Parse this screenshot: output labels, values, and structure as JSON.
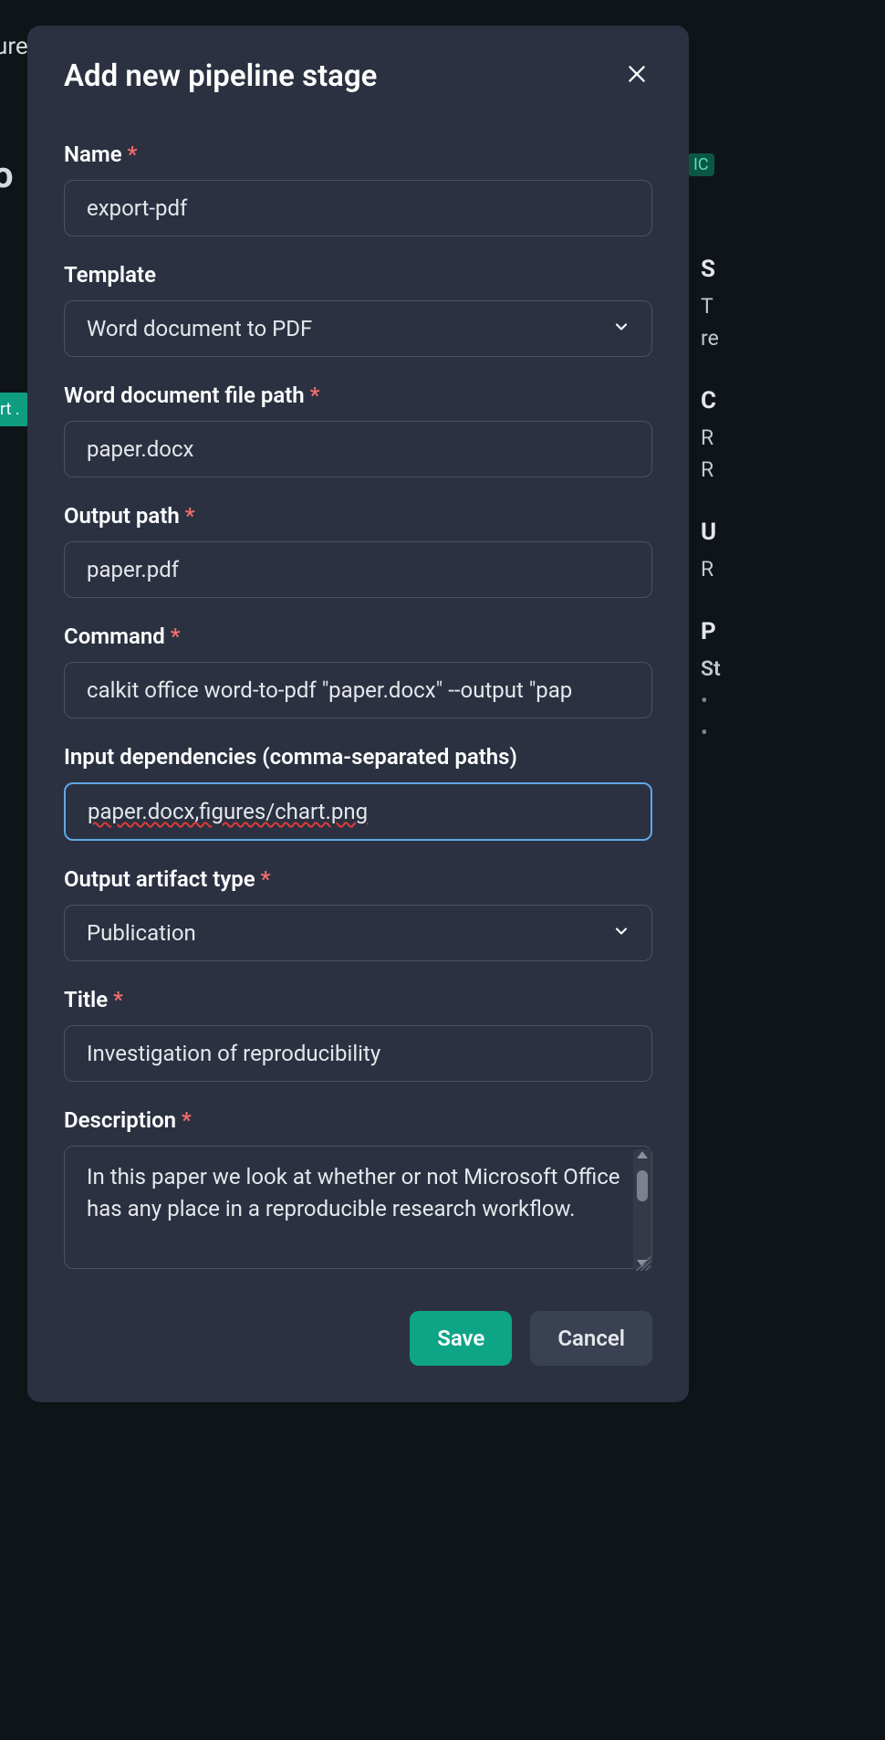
{
  "backdrop": {
    "top_left": "ure",
    "badge_rt": "rt .",
    "badge_ic": "IC",
    "title_frag": "o"
  },
  "right_panel": {
    "s_heading": "S",
    "s_line1": "T",
    "s_line2": "re",
    "c_heading": "C",
    "c_line1": "R",
    "c_line2": "R",
    "u_heading": "U",
    "u_line1": "R",
    "p_heading": "P",
    "p_sub": "St",
    "p_b1": "•",
    "p_b2": "•"
  },
  "modal": {
    "title": "Add new pipeline stage",
    "fields": {
      "name": {
        "label": "Name",
        "required": true,
        "value": "export-pdf"
      },
      "template": {
        "label": "Template",
        "required": false,
        "value": "Word document to PDF"
      },
      "word_path": {
        "label": "Word document file path",
        "required": true,
        "value": "paper.docx"
      },
      "output_path": {
        "label": "Output path",
        "required": true,
        "value": "paper.pdf"
      },
      "command": {
        "label": "Command",
        "required": true,
        "value": "calkit office word-to-pdf \"paper.docx\" --output \"pap"
      },
      "input_deps": {
        "label": "Input dependencies (comma-separated paths)",
        "required": false,
        "value": "paper.docx,figures/chart.png"
      },
      "artifact_type": {
        "label": "Output artifact type",
        "required": true,
        "value": "Publication"
      },
      "art_title": {
        "label": "Title",
        "required": true,
        "value": "Investigation of reproducibility"
      },
      "description": {
        "label": "Description",
        "required": true,
        "value": "In this paper we look at whether or not Microsoft Office has any place in a reproducible research workflow."
      }
    },
    "buttons": {
      "save": "Save",
      "cancel": "Cancel"
    }
  }
}
